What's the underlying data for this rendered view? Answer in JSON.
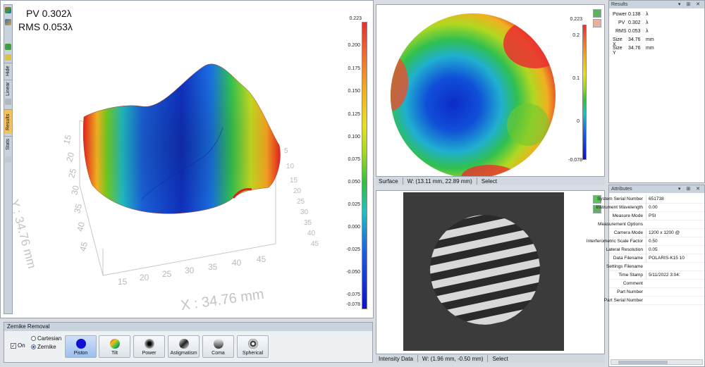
{
  "view3d": {
    "pv_label": "PV 0.302λ",
    "rms_label": "RMS 0.053λ",
    "x_axis_label": "X : 34.76 mm",
    "y_axis_label": "Y : 34.76 mm",
    "x_ticks": [
      "15",
      "20",
      "25",
      "30",
      "35",
      "40",
      "45"
    ],
    "y_ticks": [
      "15",
      "20",
      "25",
      "30",
      "35",
      "40",
      "45"
    ],
    "y_ticks_right": [
      "5",
      "10",
      "15",
      "20",
      "25",
      "30",
      "35",
      "40",
      "45"
    ]
  },
  "toolbar": {
    "hide_label": "Hide",
    "linear_label": "Linear",
    "results_label": "Results",
    "stats_label": "Stats"
  },
  "colorbar_main": {
    "max_label": "0.223",
    "min_label": "-0.078",
    "ticks": [
      "0.200",
      "0.175",
      "0.150",
      "0.125",
      "0.100",
      "0.075",
      "0.050",
      "0.025",
      "0.000",
      "-0.025",
      "-0.050",
      "-0.075"
    ]
  },
  "colorbar_small": {
    "max_label": "0.223",
    "min_label": "-0.078",
    "ticks": [
      "0.2",
      "0.1",
      "0"
    ]
  },
  "surface_status": {
    "name": "Surface",
    "coords": "W: (13.11 mm, 22.89 mm)",
    "mode": "Select"
  },
  "intensity_status": {
    "name": "Intensity Data",
    "coords": "W: (1.96 mm, -0.50 mm)",
    "mode": "Select"
  },
  "zernike": {
    "title": "Zernike Removal",
    "on_label": "On",
    "cartesian_label": "Cartesian",
    "zernike_label": "Zernike",
    "buttons": [
      "Piston",
      "Tilt",
      "Power",
      "Astigmatism",
      "Coma",
      "Spherical"
    ]
  },
  "results": {
    "title": "Results",
    "rows": [
      {
        "key": "Power",
        "value": "0.138",
        "unit": "λ"
      },
      {
        "key": "PV",
        "value": "0.302",
        "unit": "λ"
      },
      {
        "key": "RMS",
        "value": "0.053",
        "unit": "λ"
      },
      {
        "key": "Size X",
        "value": "34.76",
        "unit": "mm"
      },
      {
        "key": "Size Y",
        "value": "34.76",
        "unit": "mm"
      }
    ]
  },
  "attributes": {
    "title": "Attributes",
    "rows": [
      {
        "key": "System Serial Number",
        "value": "651738"
      },
      {
        "key": "Instrument Wavelength",
        "value": "0.00"
      },
      {
        "key": "Measure Mode",
        "value": "PSI"
      },
      {
        "key": "Measurement Options",
        "value": ""
      },
      {
        "key": "Camera Mode",
        "value": "1200 x 1200 @"
      },
      {
        "key": "Interferometric Scale Factor",
        "value": "0.50"
      },
      {
        "key": "Lateral Resolution",
        "value": "0.05"
      },
      {
        "key": "Data Filename",
        "value": "POLARIS-K15 10"
      },
      {
        "key": "Settings Filename",
        "value": ""
      },
      {
        "key": "Time Stamp",
        "value": "5/11/2022 3:04:"
      },
      {
        "key": "Comment",
        "value": ""
      },
      {
        "key": "Part Number",
        "value": ""
      },
      {
        "key": "Part Serial Number",
        "value": ""
      }
    ]
  }
}
